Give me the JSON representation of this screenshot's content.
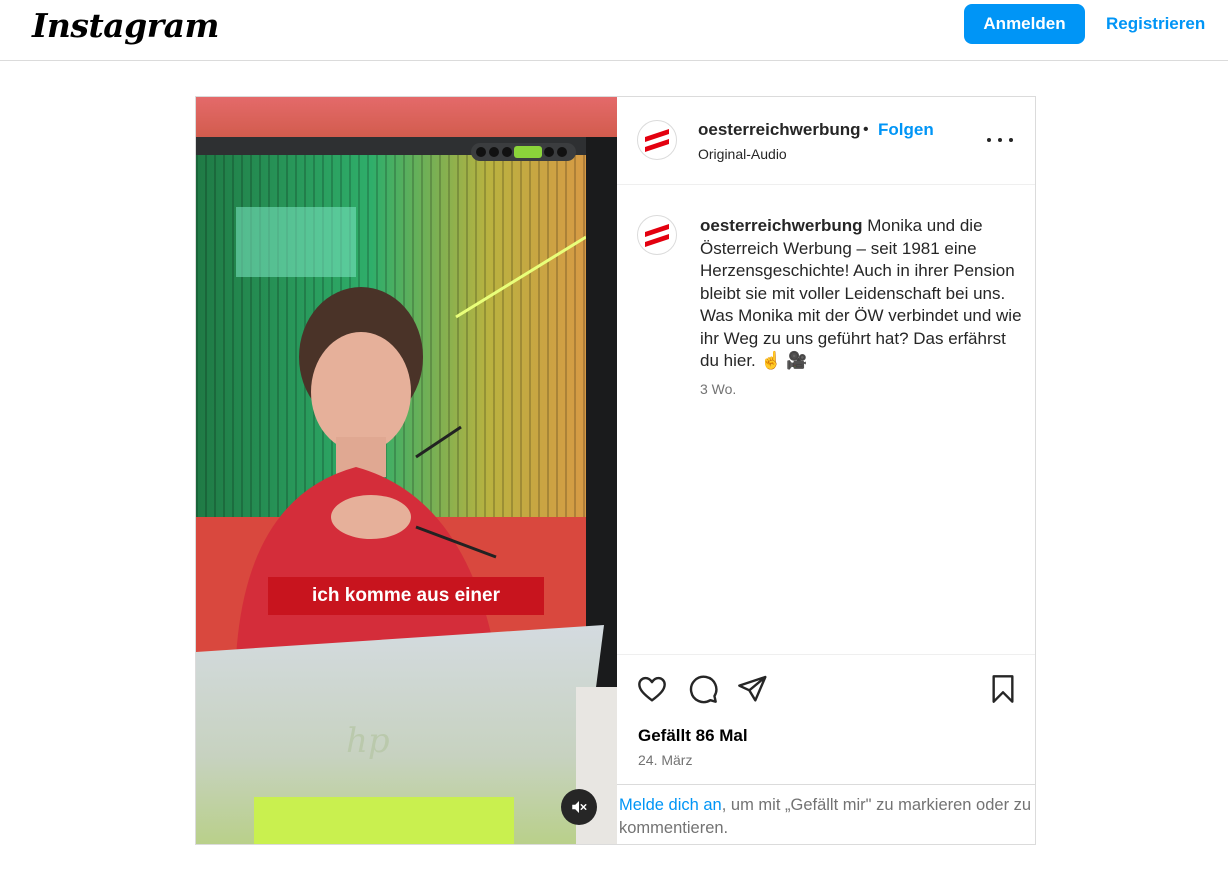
{
  "header": {
    "logo": "Instagram",
    "login_label": "Anmelden",
    "register_label": "Registrieren"
  },
  "media": {
    "subtitle": "ich komme aus einer",
    "mute_icon": "speaker-muted-icon"
  },
  "post": {
    "username": "oesterreichwerbung",
    "separator": "•",
    "follow_label": "Folgen",
    "audio": "Original-Audio",
    "caption_user": "oesterreichwerbung",
    "caption_text": "Monika und die Österreich Werbung – seit 1981 eine Herzensgeschichte! Auch in ihrer Pension bleibt sie mit voller Leidenschaft bei uns. Was Monika mit der ÖW verbindet und wie ihr Weg zu uns geführt hat? Das erfährst du hier. ☝️ 🎥",
    "time_ago": "3 Wo.",
    "likes": "Gefällt 86 Mal",
    "date": "24. März",
    "login_prompt_link": "Melde dich an",
    "login_prompt_rest": ", um mit „Gefällt mir\" zu markieren oder zu kommentieren."
  },
  "colors": {
    "accent": "#0095f6",
    "brand_red": "#e3000f",
    "subtitle_bg": "#c8141e"
  },
  "icons": [
    "heart-icon",
    "comment-icon",
    "share-icon",
    "bookmark-icon",
    "more-options-icon"
  ]
}
